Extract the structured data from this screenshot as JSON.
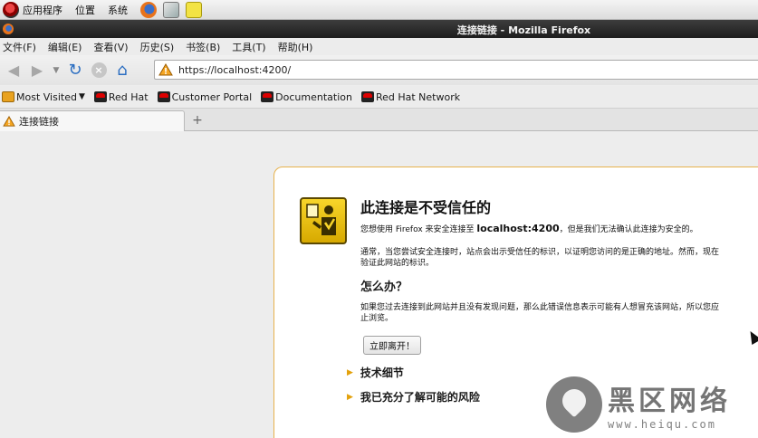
{
  "panel": {
    "menus": [
      "应用程序",
      "位置",
      "系统"
    ],
    "launchers": [
      "firefox-icon",
      "mail-icon",
      "notes-icon"
    ]
  },
  "window": {
    "title": "连接链接 - Mozilla Firefox"
  },
  "menubar": [
    "文件(F)",
    "编辑(E)",
    "查看(V)",
    "历史(S)",
    "书签(B)",
    "工具(T)",
    "帮助(H)"
  ],
  "navbar": {
    "url": "https://localhost:4200/"
  },
  "bookmarks": [
    "Most Visited",
    "Red Hat",
    "Customer Portal",
    "Documentation",
    "Red Hat Network"
  ],
  "tab": {
    "label": "连接链接",
    "new_tab": "+"
  },
  "error": {
    "title": "此连接是不受信任的",
    "p1_pre": "您想使用 Firefox 来安全连接至 ",
    "p1_host": "localhost:4200",
    "p1_post": "，但是我们无法确认此连接为安全的。",
    "p2_line1": "通常，当您尝试安全连接时，站点会出示受信任的标识，以证明您访问的是正确的地址。然而，现在",
    "p2_line2": "验证此网站的标识。",
    "what_heading": "怎么办？",
    "p3_line1": "如果您过去连接到此网站并且没有发现问题，那么此错误信息表示可能有人想冒充该网站，所以您应",
    "p3_line2": "止浏览。",
    "leave_button": "立即离开！",
    "technical_details": "技术细节",
    "understand_risks": "我已充分了解可能的风险"
  },
  "watermark": {
    "text": "黑区网络",
    "url": "www.heiqu.com"
  },
  "colors": {
    "accent_border": "#e7b24c",
    "warning_yellow": "#f8d52a",
    "triangle": "#e3a10b"
  }
}
